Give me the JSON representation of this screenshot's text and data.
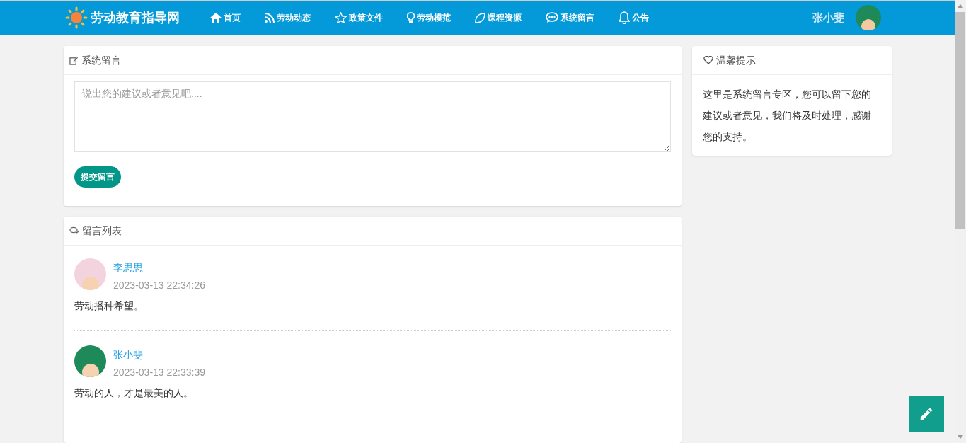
{
  "header": {
    "logo": "劳动教育指导网",
    "nav": [
      {
        "label": "首页"
      },
      {
        "label": "劳动动态"
      },
      {
        "label": "政策文件"
      },
      {
        "label": "劳动模范"
      },
      {
        "label": "课程资源"
      },
      {
        "label": "系统留言"
      },
      {
        "label": "公告"
      }
    ],
    "user": "张小斐"
  },
  "message_form": {
    "title": "系统留言",
    "placeholder": "说出您的建议或者意见吧....",
    "submit": "提交留言"
  },
  "message_list": {
    "title": "留言列表",
    "items": [
      {
        "author": "李思思",
        "time": "2023-03-13 22:34:26",
        "text": "劳动播种希望。"
      },
      {
        "author": "张小斐",
        "time": "2023-03-13 22:33:39",
        "text": "劳动的人，才是最美的人。"
      }
    ]
  },
  "tips": {
    "title": "温馨提示",
    "text": "这里是系统留言专区，您可以留下您的建议或者意见，我们将及时处理，感谢您的支持。"
  }
}
